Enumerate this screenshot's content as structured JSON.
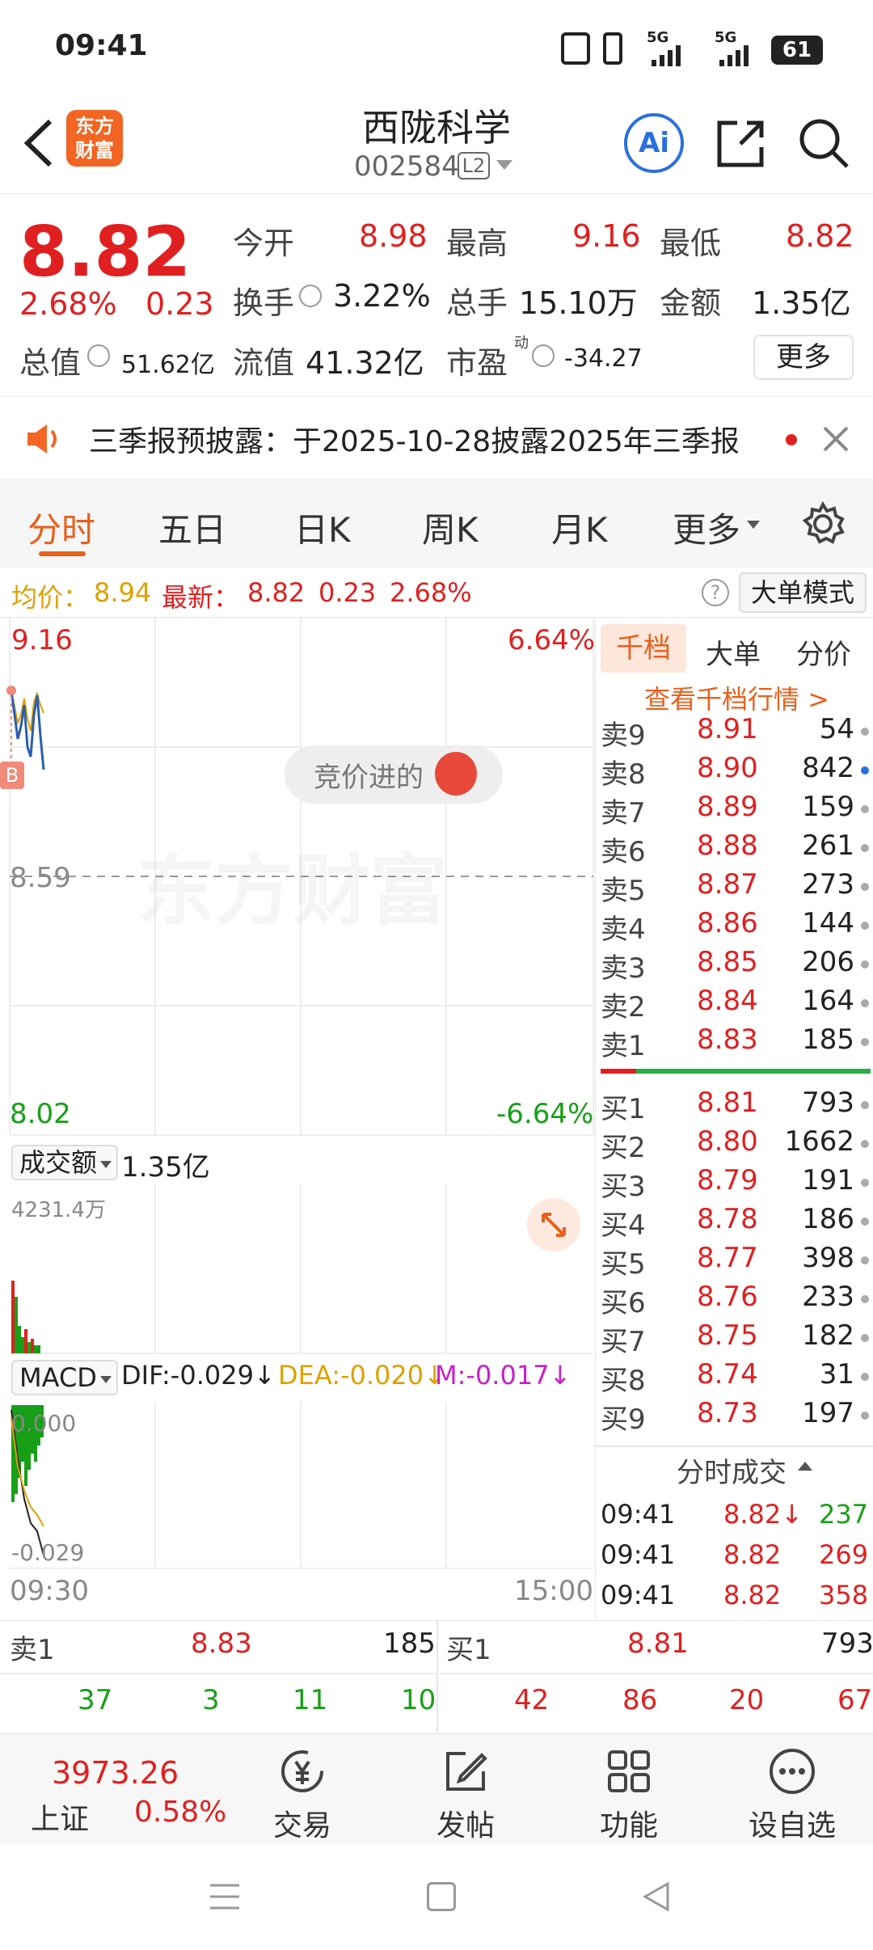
{
  "status": {
    "time": "09:41",
    "signal1": "5G",
    "signal2": "5G",
    "battery": "61"
  },
  "header": {
    "title": "西陇科学",
    "code": "002584",
    "level_badge": "L2",
    "logo_line1": "东方",
    "logo_line2": "财富",
    "ai_label": "Ai"
  },
  "quote": {
    "price": "8.82",
    "change_pct": "2.68%",
    "change": "0.23",
    "open_label": "今开",
    "open": "8.98",
    "high_label": "最高",
    "high": "9.16",
    "low_label": "最低",
    "low": "8.82",
    "turnover_label": "换手",
    "turnover": "3.22%",
    "volume_label": "总手",
    "volume": "15.10万",
    "amount_label": "金额",
    "amount": "1.35亿",
    "mktcap_label": "总值",
    "mktcap": "51.62亿",
    "float_label": "流值",
    "float": "41.32亿",
    "pe_label": "市盈",
    "pe_sup": "动",
    "pe": "-34.27",
    "more_label": "更多"
  },
  "notice": {
    "text": "三季报预披露：于2025-10-28披露2025年三季报"
  },
  "tabs": {
    "items": [
      "分时",
      "五日",
      "日K",
      "周K",
      "月K",
      "更多"
    ],
    "active": "分时"
  },
  "avgline": {
    "avg_label": "均价：",
    "avg": "8.94",
    "latest_label": "最新：",
    "latest": "8.82",
    "chg": "0.23",
    "pct": "2.68%",
    "mode_label": "大单模式"
  },
  "chart": {
    "top_price": "9.16",
    "top_pct": "6.64%",
    "mid_price": "8.59",
    "bottom_price": "8.02",
    "bottom_pct": "-6.64%",
    "auction_text": "竞价进的",
    "watermark": "东方财富",
    "buy_marker": "B",
    "volume_selector": "成交额",
    "volume_total": "1.35亿",
    "volume_max": "4231.4万",
    "macd_selector": "MACD",
    "dif": "DIF:-0.029",
    "dea": "DEA:-0.020",
    "m": "M:-0.017",
    "macd_top": "0.000",
    "macd_bottom": "-0.029",
    "time_start": "09:30",
    "time_end": "15:00",
    "colors": {
      "up": "#e02020",
      "down": "#17a017",
      "avg": "#e0a000",
      "price": "#2a5fb0"
    }
  },
  "depth": {
    "tabs": [
      "千档",
      "大单",
      "分价"
    ],
    "link": "查看千档行情 >",
    "asks": [
      {
        "label": "卖9",
        "price": "8.91",
        "vol": "54"
      },
      {
        "label": "卖8",
        "price": "8.90",
        "vol": "842"
      },
      {
        "label": "卖7",
        "price": "8.89",
        "vol": "159"
      },
      {
        "label": "卖6",
        "price": "8.88",
        "vol": "261"
      },
      {
        "label": "卖5",
        "price": "8.87",
        "vol": "273"
      },
      {
        "label": "卖4",
        "price": "8.86",
        "vol": "144"
      },
      {
        "label": "卖3",
        "price": "8.85",
        "vol": "206"
      },
      {
        "label": "卖2",
        "price": "8.84",
        "vol": "164"
      },
      {
        "label": "卖1",
        "price": "8.83",
        "vol": "185"
      }
    ],
    "bids": [
      {
        "label": "买1",
        "price": "8.81",
        "vol": "793"
      },
      {
        "label": "买2",
        "price": "8.80",
        "vol": "1662"
      },
      {
        "label": "买3",
        "price": "8.79",
        "vol": "191"
      },
      {
        "label": "买4",
        "price": "8.78",
        "vol": "186"
      },
      {
        "label": "买5",
        "price": "8.77",
        "vol": "398"
      },
      {
        "label": "买6",
        "price": "8.76",
        "vol": "233"
      },
      {
        "label": "买7",
        "price": "8.75",
        "vol": "182"
      },
      {
        "label": "买8",
        "price": "8.74",
        "vol": "31"
      },
      {
        "label": "买9",
        "price": "8.73",
        "vol": "197"
      }
    ],
    "ticks_title": "分时成交",
    "ticks": [
      {
        "time": "09:41",
        "price": "8.82↓",
        "vol": "237"
      },
      {
        "time": "09:41",
        "price": "8.82",
        "vol": "269"
      },
      {
        "time": "09:41",
        "price": "8.82",
        "vol": "358"
      }
    ]
  },
  "bottom_order": {
    "sell_label": "卖1",
    "sell_price": "8.83",
    "sell_vol": "185",
    "buy_label": "买1",
    "buy_price": "8.81",
    "buy_vol": "793",
    "sell_queue": [
      "37",
      "3",
      "11",
      "10"
    ],
    "buy_queue": [
      "42",
      "86",
      "20",
      "67"
    ]
  },
  "bottom_nav": {
    "index_value": "3973.26",
    "index_name": "上证",
    "index_pct": "0.58%",
    "items": [
      "交易",
      "发帖",
      "功能",
      "设自选"
    ]
  }
}
